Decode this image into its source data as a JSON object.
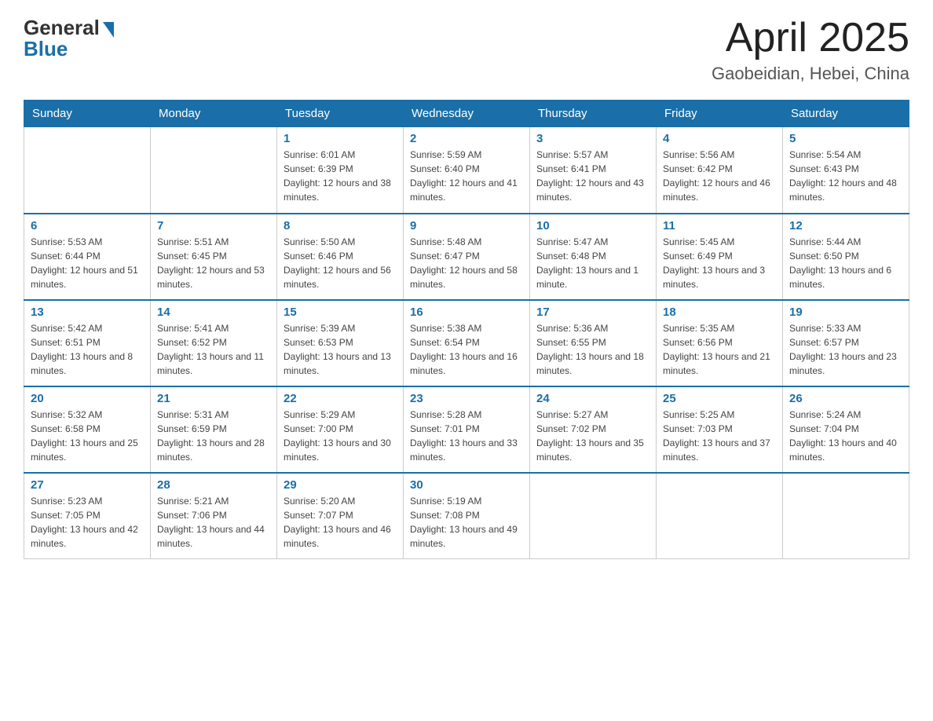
{
  "header": {
    "logo_general": "General",
    "logo_blue": "Blue",
    "month_title": "April 2025",
    "location": "Gaobeidian, Hebei, China"
  },
  "days_of_week": [
    "Sunday",
    "Monday",
    "Tuesday",
    "Wednesday",
    "Thursday",
    "Friday",
    "Saturday"
  ],
  "weeks": [
    [
      null,
      null,
      {
        "day": 1,
        "sunrise": "6:01 AM",
        "sunset": "6:39 PM",
        "daylight": "12 hours and 38 minutes."
      },
      {
        "day": 2,
        "sunrise": "5:59 AM",
        "sunset": "6:40 PM",
        "daylight": "12 hours and 41 minutes."
      },
      {
        "day": 3,
        "sunrise": "5:57 AM",
        "sunset": "6:41 PM",
        "daylight": "12 hours and 43 minutes."
      },
      {
        "day": 4,
        "sunrise": "5:56 AM",
        "sunset": "6:42 PM",
        "daylight": "12 hours and 46 minutes."
      },
      {
        "day": 5,
        "sunrise": "5:54 AM",
        "sunset": "6:43 PM",
        "daylight": "12 hours and 48 minutes."
      }
    ],
    [
      {
        "day": 6,
        "sunrise": "5:53 AM",
        "sunset": "6:44 PM",
        "daylight": "12 hours and 51 minutes."
      },
      {
        "day": 7,
        "sunrise": "5:51 AM",
        "sunset": "6:45 PM",
        "daylight": "12 hours and 53 minutes."
      },
      {
        "day": 8,
        "sunrise": "5:50 AM",
        "sunset": "6:46 PM",
        "daylight": "12 hours and 56 minutes."
      },
      {
        "day": 9,
        "sunrise": "5:48 AM",
        "sunset": "6:47 PM",
        "daylight": "12 hours and 58 minutes."
      },
      {
        "day": 10,
        "sunrise": "5:47 AM",
        "sunset": "6:48 PM",
        "daylight": "13 hours and 1 minute."
      },
      {
        "day": 11,
        "sunrise": "5:45 AM",
        "sunset": "6:49 PM",
        "daylight": "13 hours and 3 minutes."
      },
      {
        "day": 12,
        "sunrise": "5:44 AM",
        "sunset": "6:50 PM",
        "daylight": "13 hours and 6 minutes."
      }
    ],
    [
      {
        "day": 13,
        "sunrise": "5:42 AM",
        "sunset": "6:51 PM",
        "daylight": "13 hours and 8 minutes."
      },
      {
        "day": 14,
        "sunrise": "5:41 AM",
        "sunset": "6:52 PM",
        "daylight": "13 hours and 11 minutes."
      },
      {
        "day": 15,
        "sunrise": "5:39 AM",
        "sunset": "6:53 PM",
        "daylight": "13 hours and 13 minutes."
      },
      {
        "day": 16,
        "sunrise": "5:38 AM",
        "sunset": "6:54 PM",
        "daylight": "13 hours and 16 minutes."
      },
      {
        "day": 17,
        "sunrise": "5:36 AM",
        "sunset": "6:55 PM",
        "daylight": "13 hours and 18 minutes."
      },
      {
        "day": 18,
        "sunrise": "5:35 AM",
        "sunset": "6:56 PM",
        "daylight": "13 hours and 21 minutes."
      },
      {
        "day": 19,
        "sunrise": "5:33 AM",
        "sunset": "6:57 PM",
        "daylight": "13 hours and 23 minutes."
      }
    ],
    [
      {
        "day": 20,
        "sunrise": "5:32 AM",
        "sunset": "6:58 PM",
        "daylight": "13 hours and 25 minutes."
      },
      {
        "day": 21,
        "sunrise": "5:31 AM",
        "sunset": "6:59 PM",
        "daylight": "13 hours and 28 minutes."
      },
      {
        "day": 22,
        "sunrise": "5:29 AM",
        "sunset": "7:00 PM",
        "daylight": "13 hours and 30 minutes."
      },
      {
        "day": 23,
        "sunrise": "5:28 AM",
        "sunset": "7:01 PM",
        "daylight": "13 hours and 33 minutes."
      },
      {
        "day": 24,
        "sunrise": "5:27 AM",
        "sunset": "7:02 PM",
        "daylight": "13 hours and 35 minutes."
      },
      {
        "day": 25,
        "sunrise": "5:25 AM",
        "sunset": "7:03 PM",
        "daylight": "13 hours and 37 minutes."
      },
      {
        "day": 26,
        "sunrise": "5:24 AM",
        "sunset": "7:04 PM",
        "daylight": "13 hours and 40 minutes."
      }
    ],
    [
      {
        "day": 27,
        "sunrise": "5:23 AM",
        "sunset": "7:05 PM",
        "daylight": "13 hours and 42 minutes."
      },
      {
        "day": 28,
        "sunrise": "5:21 AM",
        "sunset": "7:06 PM",
        "daylight": "13 hours and 44 minutes."
      },
      {
        "day": 29,
        "sunrise": "5:20 AM",
        "sunset": "7:07 PM",
        "daylight": "13 hours and 46 minutes."
      },
      {
        "day": 30,
        "sunrise": "5:19 AM",
        "sunset": "7:08 PM",
        "daylight": "13 hours and 49 minutes."
      },
      null,
      null,
      null
    ]
  ]
}
